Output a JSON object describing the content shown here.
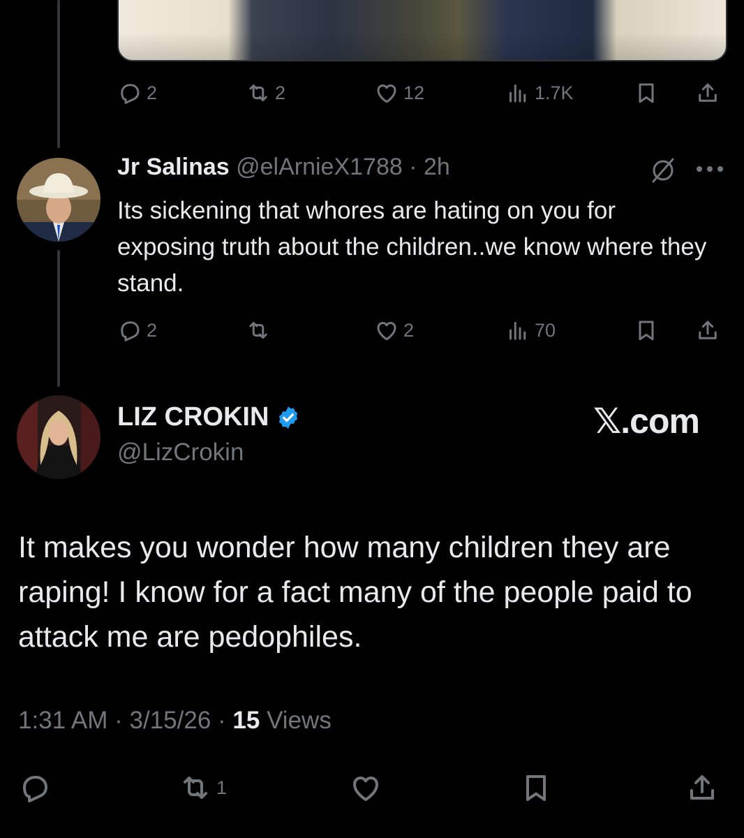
{
  "top_tweet": {
    "actions": {
      "reply_count": "2",
      "repost_count": "2",
      "like_count": "12",
      "view_count": "1.7K"
    }
  },
  "reply_tweet": {
    "display_name": "Jr Salinas",
    "handle": "@elArnieX1788",
    "separator": "·",
    "time": "2h",
    "text": "Its sickening that whores are hating on you for exposing truth about the children..we know where they stand.",
    "actions": {
      "reply_count": "2",
      "repost_count": "",
      "like_count": "2",
      "view_count": "70"
    }
  },
  "main_tweet": {
    "display_name": "LIZ CROKIN",
    "handle": "@LizCrokin",
    "watermark": "𝕏.com",
    "text": "It makes you wonder how many children they are raping! I know for a fact many of the people paid to attack me are pedophiles.",
    "meta": {
      "time": "1:31 AM",
      "sep1": " · ",
      "date": "3/15/26",
      "sep2": " · ",
      "views_count": "15",
      "views_label": " Views"
    },
    "actions": {
      "repost_count": "1"
    }
  },
  "icons": {
    "verified_color": "#1d9bf0",
    "muted_color": "#71767b"
  }
}
